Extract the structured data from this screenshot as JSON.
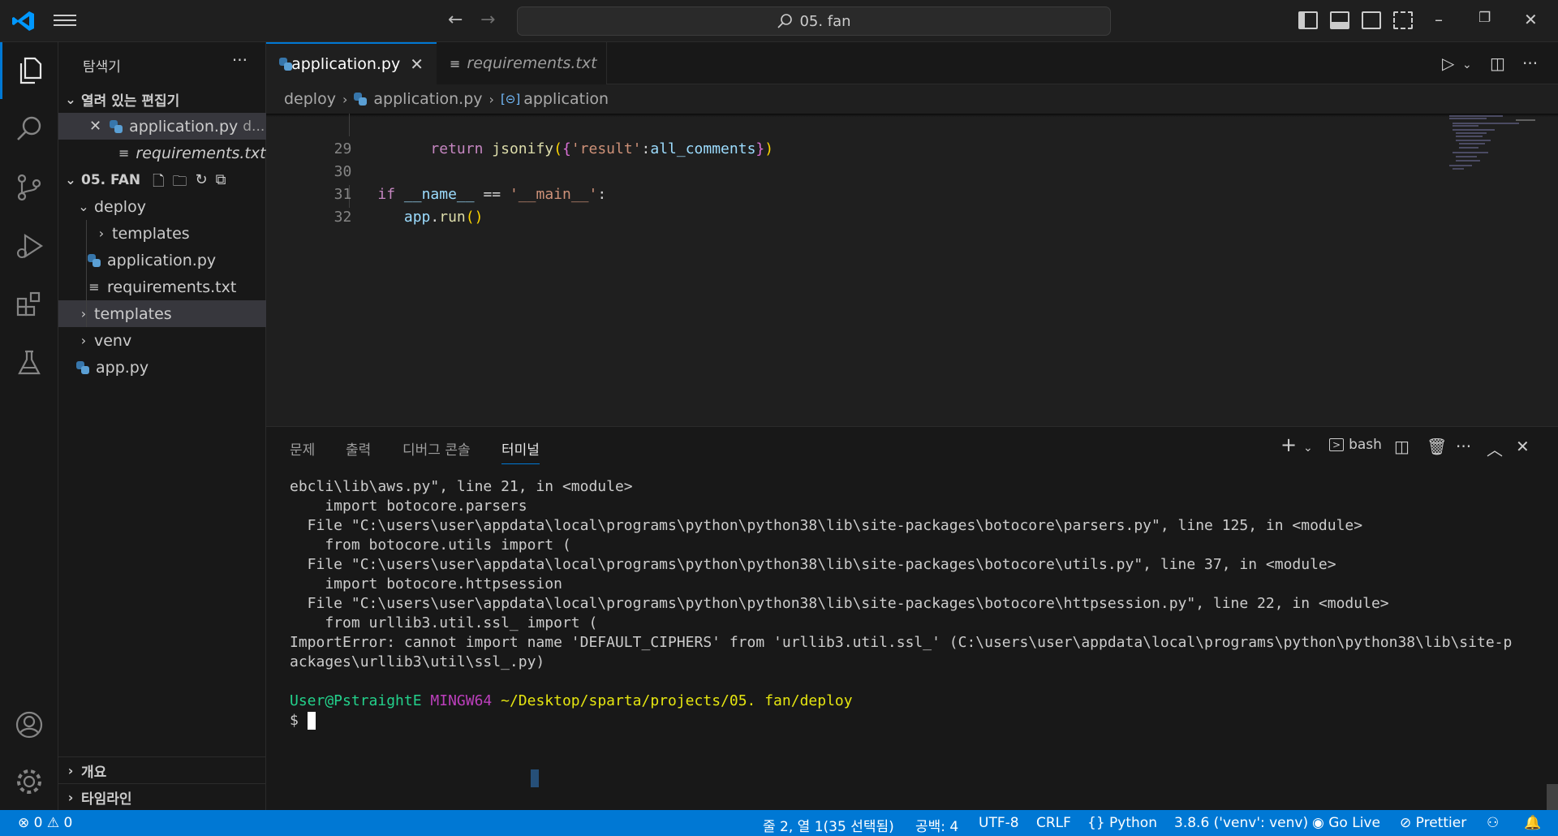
{
  "titlebar": {
    "search_text": "05. fan",
    "nav_back": "←",
    "nav_forward": "→",
    "minimize": "–",
    "restore": "❐",
    "close": "✕"
  },
  "sidebar": {
    "title": "탐색기",
    "more": "···",
    "open_editors": {
      "header": "열려 있는 편집기",
      "items": [
        {
          "label": "application.py",
          "suffix": "d...",
          "icon": "python-file-icon"
        },
        {
          "label": "requirements.txt...",
          "icon": "text-file-icon"
        }
      ]
    },
    "folder": {
      "header": "05. FAN",
      "tree": [
        {
          "label": "deploy",
          "type": "folder-open"
        },
        {
          "label": "templates",
          "type": "folder"
        },
        {
          "label": "application.py",
          "type": "python"
        },
        {
          "label": "requirements.txt",
          "type": "text"
        },
        {
          "label": "templates",
          "type": "folder"
        },
        {
          "label": "venv",
          "type": "folder"
        },
        {
          "label": "app.py",
          "type": "python"
        }
      ]
    },
    "outline": "개요",
    "timeline": "타임라인"
  },
  "tabs": [
    {
      "label": "application.py",
      "active": true,
      "close": "✕"
    },
    {
      "label": "requirements.txt",
      "active": false
    }
  ],
  "breadcrumb": {
    "folder": "deploy",
    "file": "application.py",
    "symbol": "application"
  },
  "editor": {
    "lines": [
      {
        "num": "29",
        "tokens": [
          "return",
          "jsonify",
          "(",
          "{",
          "'result'",
          ":",
          "all_comments",
          "}",
          ")"
        ]
      },
      {
        "num": "30",
        "tokens": []
      },
      {
        "num": "31",
        "tokens": [
          "if",
          "__name__",
          "==",
          "'__main__'",
          ":"
        ]
      },
      {
        "num": "32",
        "tokens": [
          "app",
          ".",
          "run",
          "()"
        ]
      }
    ]
  },
  "panel": {
    "tabs": [
      "문제",
      "출력",
      "디버그 콘솔",
      "터미널"
    ],
    "active_tab": "터미널",
    "terminal_profile": "bash",
    "terminal_lines": [
      "ebcli\\lib\\aws.py\", line 21, in <module>",
      "    import botocore.parsers",
      "  File \"C:\\users\\user\\appdata\\local\\programs\\python\\python38\\lib\\site-packages\\botocore\\parsers.py\", line 125, in <module>",
      "    from botocore.utils import (",
      "  File \"C:\\users\\user\\appdata\\local\\programs\\python\\python38\\lib\\site-packages\\botocore\\utils.py\", line 37, in <module>",
      "    import botocore.httpsession",
      "  File \"C:\\users\\user\\appdata\\local\\programs\\python\\python38\\lib\\site-packages\\botocore\\httpsession.py\", line 22, in <module>",
      "    from urllib3.util.ssl_ import (",
      "ImportError: cannot import name 'DEFAULT_CIPHERS' from 'urllib3.util.ssl_' (C:\\users\\user\\appdata\\local\\programs\\python\\python38\\lib\\site-p",
      "ackages\\urllib3\\util\\ssl_.py)"
    ],
    "prompt_user": "User@PstraightE",
    "prompt_env": "MINGW64",
    "prompt_path": "~/Desktop/sparta/projects/05. fan/deploy",
    "prompt_symbol": "$"
  },
  "statusbar": {
    "errors": "0",
    "warnings": "0",
    "position": "줄 2, 열 1(35 선택됨)",
    "spaces": "공백: 4",
    "encoding": "UTF-8",
    "eol": "CRLF",
    "language": "Python",
    "interpreter": "3.8.6 ('venv': venv)",
    "golive": "Go Live",
    "prettier": "Prettier"
  },
  "colors": {
    "accent": "#0078d4",
    "statusbar": "#0078d4",
    "background": "#1f1f1f"
  }
}
